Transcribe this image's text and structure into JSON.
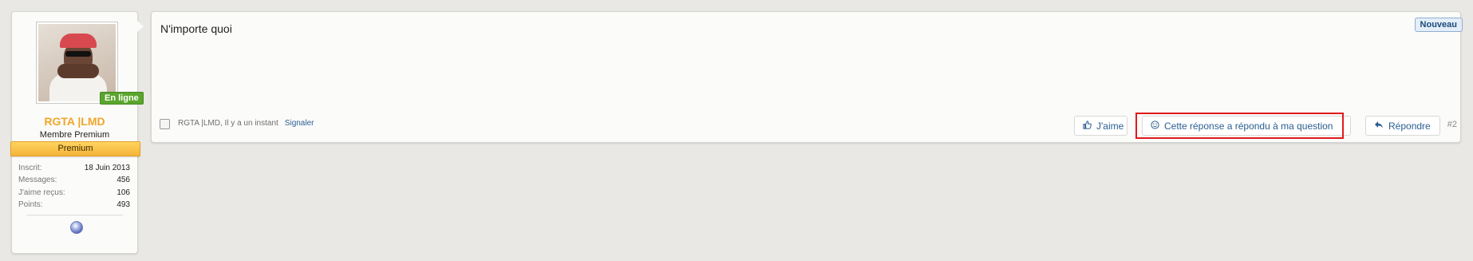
{
  "user": {
    "online_label": "En ligne",
    "username": "RGTA |LMD",
    "title": "Membre Premium",
    "banner": "Premium",
    "stats": [
      {
        "label": "Inscrit:",
        "value": "18 Juin 2013"
      },
      {
        "label": "Messages:",
        "value": "456"
      },
      {
        "label": "J'aime reçus:",
        "value": "106"
      },
      {
        "label": "Points:",
        "value": "493"
      }
    ],
    "accent_color": "#f0a62a"
  },
  "message": {
    "text": "N'importe quoi",
    "new_badge": "Nouveau",
    "author_time": "RGTA |LMD, Il y a un instant",
    "report_label": "Signaler",
    "like_label": "J'aime",
    "answer_label": "Cette réponse a répondu à ma question",
    "reply_label": "Répondre",
    "post_number": "#2"
  },
  "icons": {
    "like": "thumbs-up-icon",
    "answer": "smiley-icon",
    "reply": "reply-arrow-icon",
    "trophy": "trophy-icon"
  }
}
